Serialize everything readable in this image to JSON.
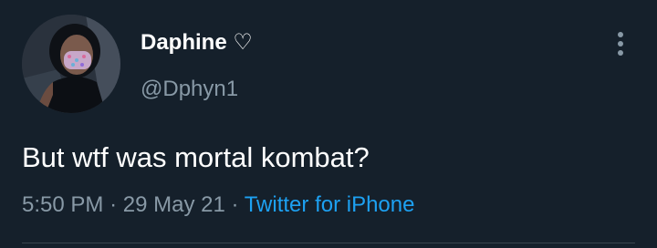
{
  "tweet": {
    "display_name": "Daphine",
    "name_emoji": "♡",
    "handle": "@Dphyn1",
    "text": "But wtf was mortal kombat?",
    "time": "5:50 PM",
    "separator": "·",
    "date": "29 May 21",
    "source": "Twitter for iPhone",
    "more_icon": "vertical-ellipsis-icon"
  },
  "colors": {
    "background": "#15202b",
    "primary_text": "#ffffff",
    "secondary_text": "#8899a6",
    "link": "#1da1f2",
    "divider": "#38444d"
  }
}
